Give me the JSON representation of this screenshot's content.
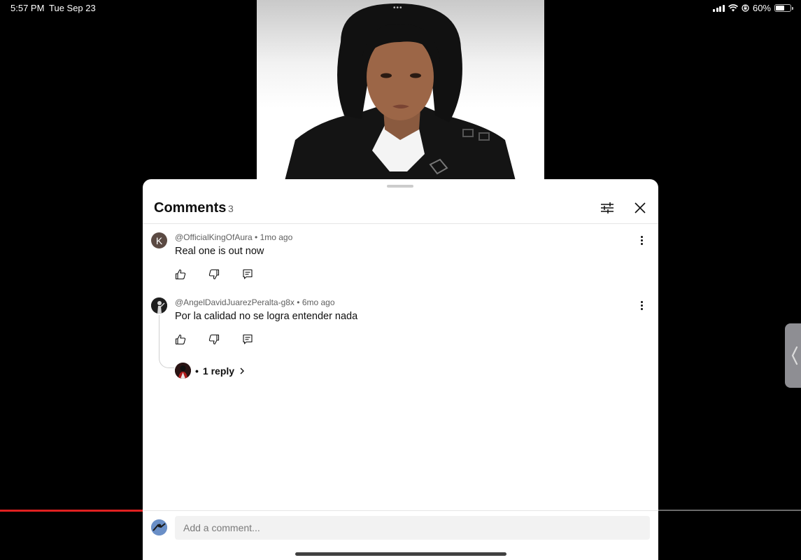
{
  "status_bar": {
    "time": "5:57 PM",
    "date": "Tue Sep 23",
    "battery": "60%",
    "battery_level": 0.6
  },
  "video": {
    "pager_dots": "•••"
  },
  "comments_panel": {
    "title": "Comments",
    "count": "3",
    "filter_icon": "sliders-icon",
    "close_icon": "close-icon"
  },
  "comments": [
    {
      "avatar_letter": "K",
      "author": "@OfficialKingOfAura",
      "time": "1mo ago",
      "text": "Real one is out now"
    },
    {
      "author": "@AngelDavidJuarezPeralta-g8x",
      "time": "6mo ago",
      "text": "Por la calidad no se logra entender nada",
      "replies_label": "1 reply"
    }
  ],
  "footer": {
    "placeholder": "Add a comment..."
  },
  "colors": {
    "progress": "#e02020",
    "sheet_bg": "#ffffff",
    "input_bg": "#f2f2f2"
  }
}
